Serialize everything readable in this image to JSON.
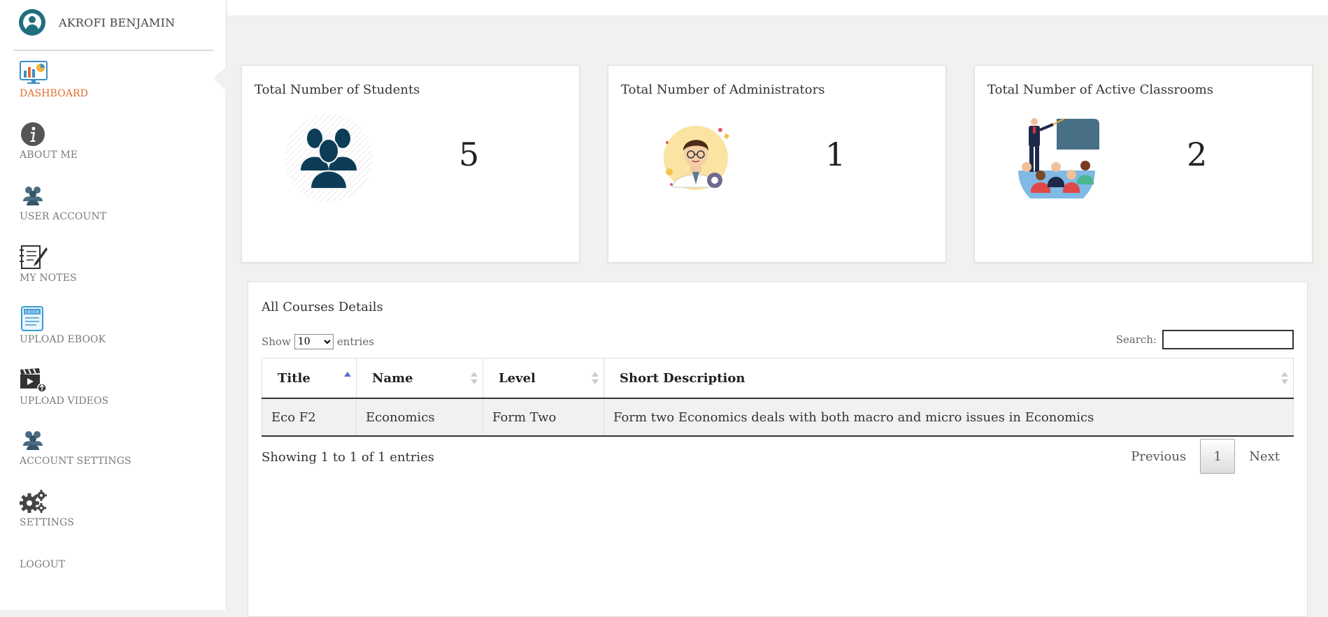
{
  "user": {
    "name": "AKROFI BENJAMIN"
  },
  "sidebar": {
    "items": [
      {
        "label": "DASHBOARD",
        "icon": "dashboard-monitor-icon",
        "active": true
      },
      {
        "label": "ABOUT ME",
        "icon": "info-icon"
      },
      {
        "label": "USER ACCOUNT",
        "icon": "users-icon"
      },
      {
        "label": "MY NOTES",
        "icon": "notes-icon"
      },
      {
        "label": "UPLOAD EBOOK",
        "icon": "ebook-icon"
      },
      {
        "label": "UPLOAD VIDEOS",
        "icon": "video-clapper-icon"
      },
      {
        "label": "ACCOUNT SETTINGS",
        "icon": "users-icon"
      },
      {
        "label": "SETTINGS",
        "icon": "gears-icon"
      },
      {
        "label": "LOGOUT"
      }
    ],
    "active_color": "#e36b2e"
  },
  "stats": [
    {
      "title": "Total Number of Students",
      "value": "5",
      "icon": "students-group-icon"
    },
    {
      "title": "Total Number of Administrators",
      "value": "1",
      "icon": "administrator-avatar-icon"
    },
    {
      "title": "Total Number of Active Classrooms",
      "value": "2",
      "icon": "classroom-teacher-icon"
    }
  ],
  "courses": {
    "title": "All Courses Details",
    "show_prefix": "Show",
    "show_value": "10",
    "show_suffix": "entries",
    "search_label": "Search:",
    "search_value": "",
    "columns": [
      "Title",
      "Name",
      "Level",
      "Short Description"
    ],
    "sorted_column": "Title",
    "rows": [
      [
        "Eco F2",
        "Economics",
        "Form Two",
        "Form two Economics deals with both macro and micro issues in Economics"
      ]
    ],
    "info": "Showing 1 to 1 of 1 entries",
    "pagination": {
      "previous": "Previous",
      "current": "1",
      "next": "Next"
    }
  }
}
